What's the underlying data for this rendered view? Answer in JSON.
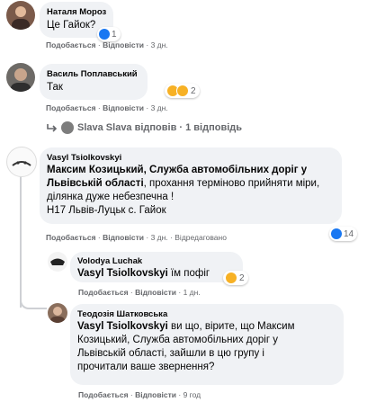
{
  "comments": [
    {
      "author": "Наталя Мороз",
      "text": "Це Гайок?",
      "reaction_count": "1",
      "actions": {
        "like": "Подобається",
        "reply": "Відповісти",
        "time": "3 дн."
      }
    },
    {
      "author": "Василь Поплавський",
      "text": "Так",
      "reaction_count": "2",
      "actions": {
        "like": "Подобається",
        "reply": "Відповісти",
        "time": "3 дн."
      },
      "replies_link": "Slava Slava відповів · 1 відповідь"
    },
    {
      "author": "Vasyl Tsiolkovskyi",
      "text_tag": "Максим Козицький, Служба автомобільних доріг у Львівській області",
      "text_rest": ", прохання терміново прийняти міри, ділянка дуже небезпечна !",
      "text_line2": "Н17 Львів-Луцьк с. Гайок",
      "reaction_count": "14",
      "actions": {
        "like": "Подобається",
        "reply": "Відповісти",
        "time": "3 дн.",
        "edited": "Відредаговано"
      }
    }
  ],
  "replies": [
    {
      "author": "Volodya Luchak",
      "text_tag": "Vasyl Tsiolkovskyi",
      "text_rest": " їм пофіг",
      "reaction_count": "2",
      "actions": {
        "like": "Подобається",
        "reply": "Відповісти",
        "time": "1 дн."
      }
    },
    {
      "author": "Теодозія Шатковська",
      "text_tag": "Vasyl Tsiolkovskyi",
      "text_rest": " ви що, вірите, що Максим Козицький, Служба автомобільних доріг у Львівській області, зайшли в цю групу і прочитали ваше звернення?",
      "actions": {
        "like": "Подобається",
        "reply": "Відповісти",
        "time": "9 год"
      }
    }
  ],
  "colors": {
    "bubble": "#f0f2f5",
    "meta": "#65676b",
    "like": "#1877f2"
  }
}
